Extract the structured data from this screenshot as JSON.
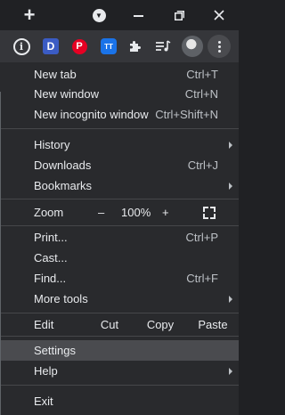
{
  "titlebar": {
    "new_tab_icon": "plus-icon",
    "tab_search_icon": "chevron-down-icon",
    "minimize_icon": "minimize-icon",
    "restore_icon": "restore-icon",
    "close_icon": "close-icon"
  },
  "toolbar": {
    "extensions": [
      {
        "name": "info-icon",
        "glyph": "i"
      },
      {
        "name": "extension-d-icon",
        "glyph": "D"
      },
      {
        "name": "pinterest-icon",
        "glyph": "P"
      },
      {
        "name": "extension-tt-icon",
        "glyph": "TT"
      },
      {
        "name": "puzzle-icon",
        "glyph": "✚"
      },
      {
        "name": "media-control-icon",
        "glyph": "≡♪"
      }
    ],
    "avatar_icon": "avatar",
    "menu_icon": "three-dots-icon"
  },
  "menu": {
    "group1": [
      {
        "label": "New tab",
        "shortcut": "Ctrl+T"
      },
      {
        "label": "New window",
        "shortcut": "Ctrl+N"
      },
      {
        "label": "New incognito window",
        "shortcut": "Ctrl+Shift+N"
      }
    ],
    "group2": [
      {
        "label": "History",
        "shortcut": ""
      },
      {
        "label": "Downloads",
        "shortcut": "Ctrl+J"
      },
      {
        "label": "Bookmarks",
        "shortcut": ""
      }
    ],
    "zoom": {
      "label": "Zoom",
      "minus": "–",
      "value": "100%",
      "plus": "+"
    },
    "group3": [
      {
        "label": "Print...",
        "shortcut": "Ctrl+P"
      },
      {
        "label": "Cast...",
        "shortcut": ""
      },
      {
        "label": "Find...",
        "shortcut": "Ctrl+F"
      },
      {
        "label": "More tools",
        "shortcut": ""
      }
    ],
    "edit": {
      "label": "Edit",
      "cut": "Cut",
      "copy": "Copy",
      "paste": "Paste"
    },
    "group4": [
      {
        "label": "Settings",
        "shortcut": ""
      },
      {
        "label": "Help",
        "shortcut": ""
      }
    ],
    "exit": {
      "label": "Exit"
    }
  },
  "colors": {
    "menu_bg": "#292a2d",
    "hover_bg": "#4a4b4f",
    "text": "#e8eaed",
    "shortcut_text": "#bdc1c6"
  }
}
